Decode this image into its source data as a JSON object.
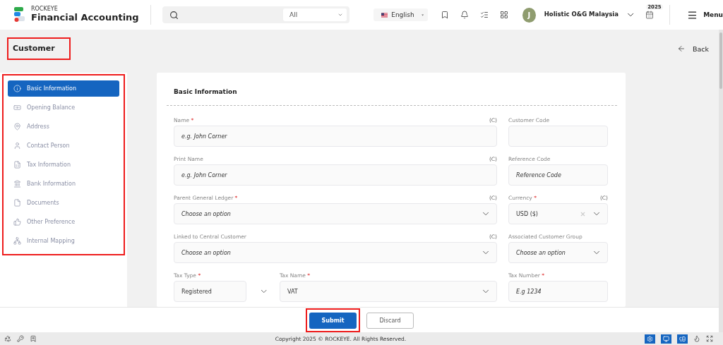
{
  "header": {
    "brand_small": "ROCKEYE",
    "brand": "Financial Accounting",
    "search": {
      "scope": "All"
    },
    "language": "English",
    "avatar": "J",
    "company": "Holistic O&G Malaysia",
    "year": "2025",
    "menu": "Menu"
  },
  "page": {
    "title": "Customer",
    "title_annotated": true,
    "back": "Back"
  },
  "sidebar": {
    "annotated": true,
    "items": [
      {
        "label": "Basic Information",
        "selected": true
      },
      {
        "label": "Opening Balance",
        "selected": false
      },
      {
        "label": "Address",
        "selected": false
      },
      {
        "label": "Contact Person",
        "selected": false
      },
      {
        "label": "Tax Information",
        "selected": false
      },
      {
        "label": "Bank Information",
        "selected": false
      },
      {
        "label": "Documents",
        "selected": false
      },
      {
        "label": "Other Preference",
        "selected": false
      },
      {
        "label": "Internal Mapping",
        "selected": false
      }
    ]
  },
  "form": {
    "heading": "Basic Information",
    "rows": [
      {
        "fields": [
          {
            "kind": "text",
            "label": "Name",
            "required_mark": "*",
            "marker": "(C)",
            "placeholder": "e.g. John Corner"
          },
          {
            "kind": "text",
            "label": "Customer Code"
          }
        ]
      },
      {
        "fields": [
          {
            "kind": "text",
            "label": "Print Name",
            "marker": "(C)",
            "placeholder": "e.g. John Corner"
          },
          {
            "kind": "text",
            "label": "Reference Code",
            "placeholder": "Reference Code"
          }
        ]
      },
      {
        "fields": [
          {
            "kind": "select",
            "label": "Parent General Ledger",
            "required_mark": "*",
            "marker": "(C)",
            "placeholder": "Choose an option"
          },
          {
            "kind": "select",
            "label": "Currency",
            "required_mark": "*",
            "marker": "(C)",
            "value": "USD ($)",
            "clearable": true
          }
        ]
      },
      {
        "fields": [
          {
            "kind": "select",
            "label": "Linked to Central Customer",
            "marker": "(C)",
            "placeholder": "Choose an option"
          },
          {
            "kind": "select",
            "label": "Associated Customer Group",
            "placeholder": "Choose an option"
          }
        ]
      },
      {
        "fields": [
          {
            "kind": "split-select",
            "label": "Tax Type",
            "required_mark": "*",
            "value": "Registered"
          },
          {
            "kind": "select",
            "label": "Tax Name",
            "required_mark": "*",
            "value": "VAT"
          },
          {
            "kind": "text",
            "label": "Tax Number",
            "required_mark": "*",
            "placeholder": "E.g 1234"
          }
        ]
      }
    ]
  },
  "actions": [
    {
      "label": "Submit",
      "kind": "primary",
      "annotated": true
    },
    {
      "label": "Discard",
      "kind": "secondary"
    }
  ],
  "status_bar": {
    "copyright": "Copyright 2025 © ROCKEYE. All Rights Reserved."
  }
}
